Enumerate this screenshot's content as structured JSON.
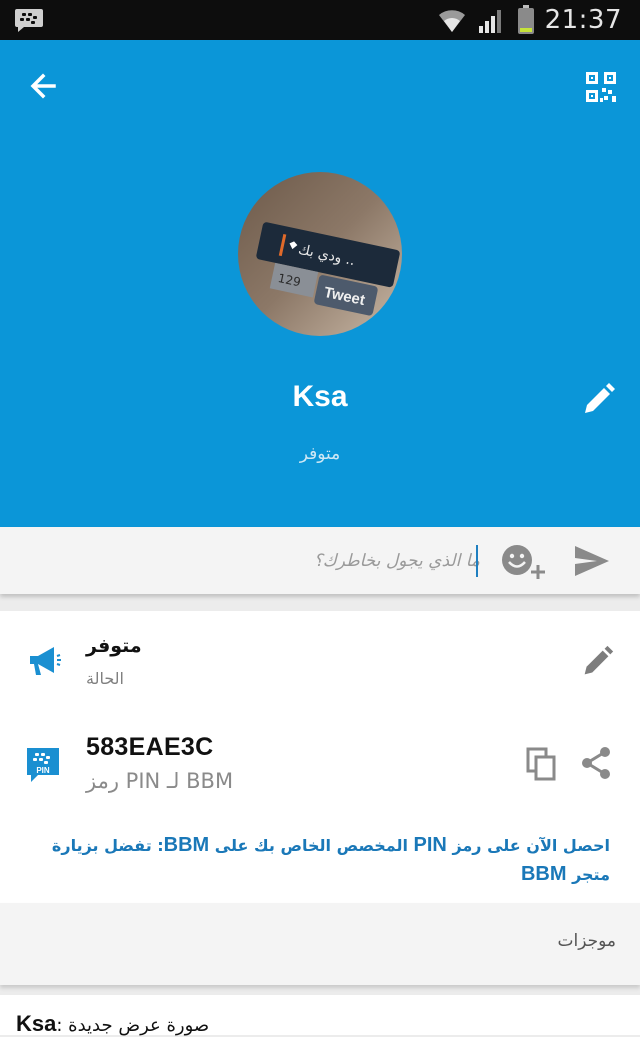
{
  "status_bar": {
    "time": "21:37",
    "icons": [
      "bbm-notification-icon",
      "wifi-icon",
      "signal-icon",
      "battery-icon"
    ]
  },
  "header": {
    "background": "#0b96d8",
    "name": "Ksa",
    "status": "متوفر",
    "avatar_text": {
      "line1": "ودي بك ..",
      "counter": "129",
      "tweet": "Tweet"
    }
  },
  "composer": {
    "placeholder": "ما الذي يجول بخاطرك؟",
    "value": ""
  },
  "info": {
    "status_title": "متوفر",
    "status_label": "الحالة",
    "pin_value": "583EAE3C",
    "pin_label": "رمز PIN لـ BBM",
    "pin_badge": "PIN",
    "promo_pre": "احصل الآن على رمز ",
    "promo_pin": "PIN",
    "promo_mid": " المخصص الخاص بك على ",
    "promo_bbm": "BBM",
    "promo_post": ": تفضل بزيارة متجر ",
    "promo_bbm2": "BBM"
  },
  "feeds": {
    "label": "موجزات",
    "entry_name": "Ksa",
    "entry_text": ": صورة عرض جديدة"
  },
  "colors": {
    "accent": "#0b96d8",
    "link": "#1a78b8"
  }
}
